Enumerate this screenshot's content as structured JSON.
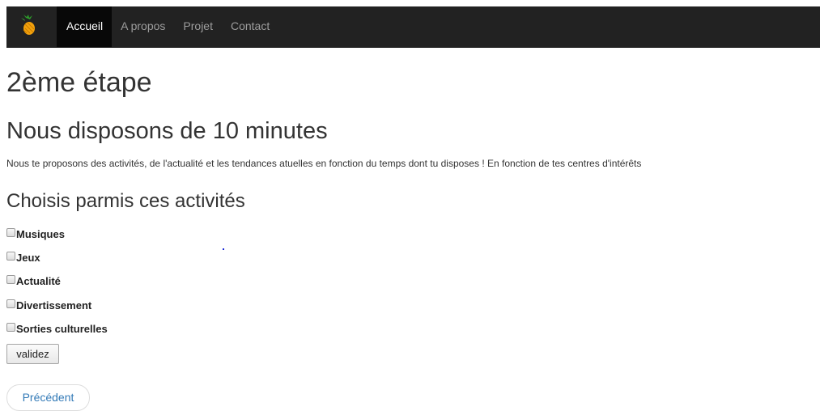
{
  "navbar": {
    "logo": "pineapple-icon",
    "items": [
      {
        "label": "Accueil",
        "active": true
      },
      {
        "label": "A propos",
        "active": false
      },
      {
        "label": "Projet",
        "active": false
      },
      {
        "label": "Contact",
        "active": false
      }
    ]
  },
  "main": {
    "step_title": "2ème étape",
    "minutes_title": "Nous disposons de 10 minutes",
    "intro": "Nous te proposons des activités, de l'actualité et les tendances atuelles en fonction du temps dont tu disposes ! En fonction de tes centres d'intérêts",
    "choose_title": "Choisis parmis ces activités",
    "activities": [
      {
        "label": "Musiques",
        "checked": false
      },
      {
        "label": "Jeux",
        "checked": false
      },
      {
        "label": "Actualité",
        "checked": false
      },
      {
        "label": "Divertissement",
        "checked": false
      },
      {
        "label": "Sorties culturelles",
        "checked": false
      }
    ],
    "submit_label": "validez",
    "previous_label": "Précédent"
  },
  "colors": {
    "navbar_bg": "#222222",
    "nav_active_bg": "#080808",
    "link": "#337ab7"
  }
}
